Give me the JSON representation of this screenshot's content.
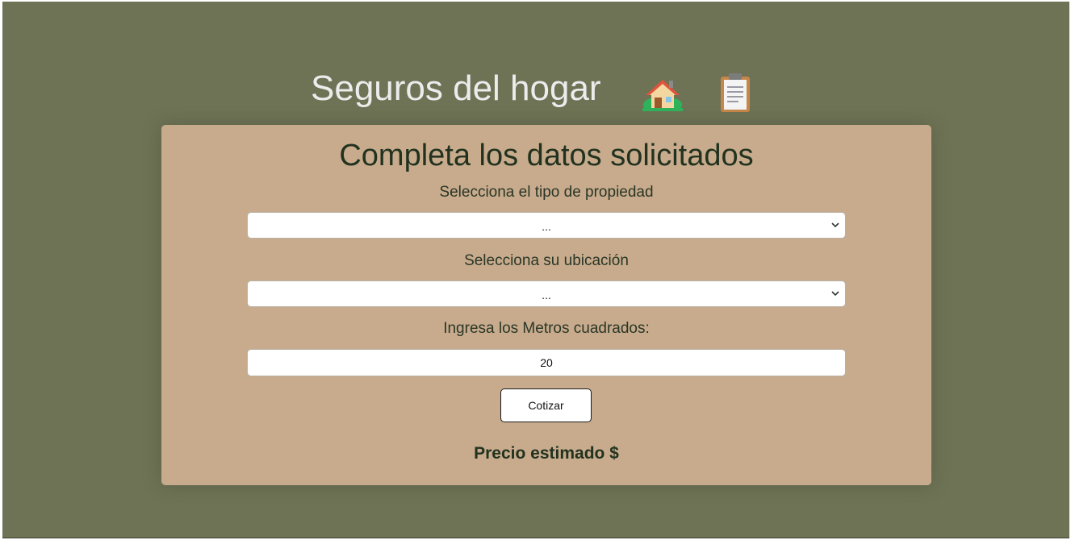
{
  "header": {
    "title": "Seguros del hogar",
    "icons": [
      "house-icon",
      "clipboard-icon"
    ]
  },
  "form": {
    "heading": "Completa los datos solicitados",
    "property_type": {
      "label": "Selecciona el tipo de propiedad",
      "selected": "..."
    },
    "location": {
      "label": "Selecciona su ubicación",
      "selected": "..."
    },
    "square_meters": {
      "label": "Ingresa los Metros cuadrados:",
      "value": "20"
    },
    "quote_button_label": "Cotizar",
    "price_label": "Precio estimado $"
  },
  "colors": {
    "background": "#6e7356",
    "card": "#c7ab8c",
    "title_text": "#ececec",
    "heading_text": "#22321f"
  }
}
